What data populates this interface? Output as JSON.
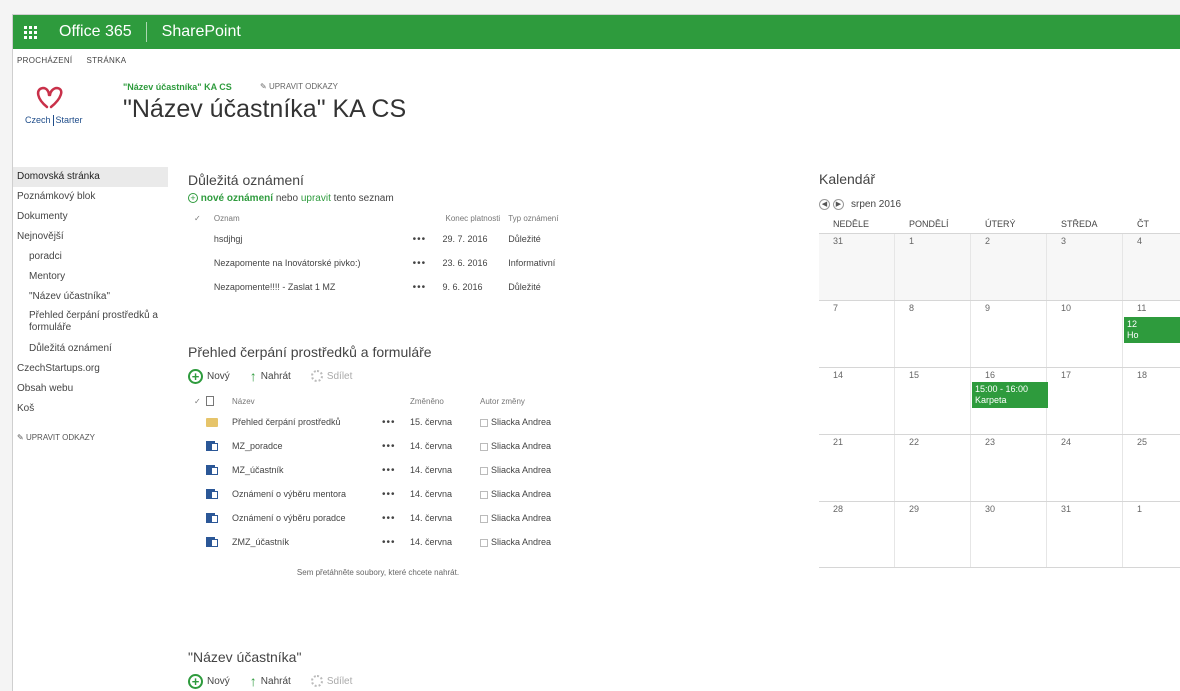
{
  "suite": {
    "brand": "Office 365",
    "app": "SharePoint"
  },
  "ribbon": {
    "tabs": [
      "PROCHÁZENÍ",
      "STRÁNKA"
    ]
  },
  "header": {
    "logo_text_left": "Czech",
    "logo_text_right": "Starter",
    "breadcrumb": "\"Název účastníka\" KA CS",
    "edit_links": "UPRAVIT ODKAZY",
    "title": "\"Název účastníka\" KA CS"
  },
  "leftnav": {
    "items": [
      "Domovská stránka",
      "Poznámkový blok",
      "Dokumenty",
      "Nejnovější",
      "poradci",
      "Mentory",
      "\"Název účastníka\"",
      "Přehled čerpání prostředků a formuláře",
      "Důležitá oznámení",
      "CzechStartups.org",
      "Obsah webu",
      "Koš"
    ],
    "edit_links": "UPRAVIT ODKAZY"
  },
  "announcements": {
    "title": "Důležitá oznámení",
    "new_link": "nové oznámení",
    "or_text": "nebo",
    "edit_link": "upravit",
    "list_text": "tento seznam",
    "columns": {
      "title": "Oznam",
      "expires": "Konec platnosti",
      "type": "Typ oznámení"
    },
    "rows": [
      {
        "title": "hsdjhgj",
        "expires": "29. 7. 2016",
        "type": "Důležité"
      },
      {
        "title": "Nezapomente na Inovátorské pivko:)",
        "expires": "23. 6. 2016",
        "type": "Informativní"
      },
      {
        "title": "Nezapomente!!!! - Zaslat 1 MZ",
        "expires": "9. 6. 2016",
        "type": "Důležité"
      }
    ]
  },
  "documents": {
    "title": "Přehled čerpání prostředků a formuláře",
    "cmd_new": "Nový",
    "cmd_upload": "Nahrát",
    "cmd_share": "Sdílet",
    "columns": {
      "name": "Název",
      "modified": "Změněno",
      "author": "Autor změny"
    },
    "rows": [
      {
        "kind": "folder",
        "name": "Přehled čerpání prostředků",
        "modified": "15. června",
        "author": "Sliacka Andrea"
      },
      {
        "kind": "doc",
        "name": "MZ_poradce",
        "modified": "14. června",
        "author": "Sliacka Andrea"
      },
      {
        "kind": "doc",
        "name": "MZ_účastník",
        "modified": "14. června",
        "author": "Sliacka Andrea"
      },
      {
        "kind": "doc",
        "name": "Oznámení o výběru mentora",
        "modified": "14. června",
        "author": "Sliacka Andrea"
      },
      {
        "kind": "doc",
        "name": "Oznámení o výběru poradce",
        "modified": "14. června",
        "author": "Sliacka Andrea"
      },
      {
        "kind": "doc",
        "name": "ZMZ_účastník",
        "modified": "14. června",
        "author": "Sliacka Andrea"
      }
    ],
    "drop_hint": "Sem přetáhněte soubory, které chcete nahrát."
  },
  "nazev": {
    "title": "\"Název účastníka\"",
    "cmd_new": "Nový",
    "cmd_upload": "Nahrát",
    "cmd_share": "Sdílet"
  },
  "calendar": {
    "title": "Kalendář",
    "month": "srpen 2016",
    "days": [
      "NEDĚLE",
      "PONDĚLÍ",
      "ÚTERÝ",
      "STŘEDA",
      "ČT"
    ],
    "weeks": [
      [
        "31",
        "1",
        "2",
        "3",
        "4"
      ],
      [
        "7",
        "8",
        "9",
        "10",
        "11"
      ],
      [
        "14",
        "15",
        "16",
        "17",
        "18"
      ],
      [
        "21",
        "22",
        "23",
        "24",
        "25"
      ],
      [
        "28",
        "29",
        "30",
        "31",
        "1"
      ]
    ],
    "events": [
      {
        "week": 1,
        "day": 4,
        "time": "12",
        "title": "Ho"
      },
      {
        "week": 2,
        "day": 2,
        "time": "15:00 - 16:00",
        "title": "Karpeta"
      }
    ],
    "accent": "#2e9b3d"
  }
}
